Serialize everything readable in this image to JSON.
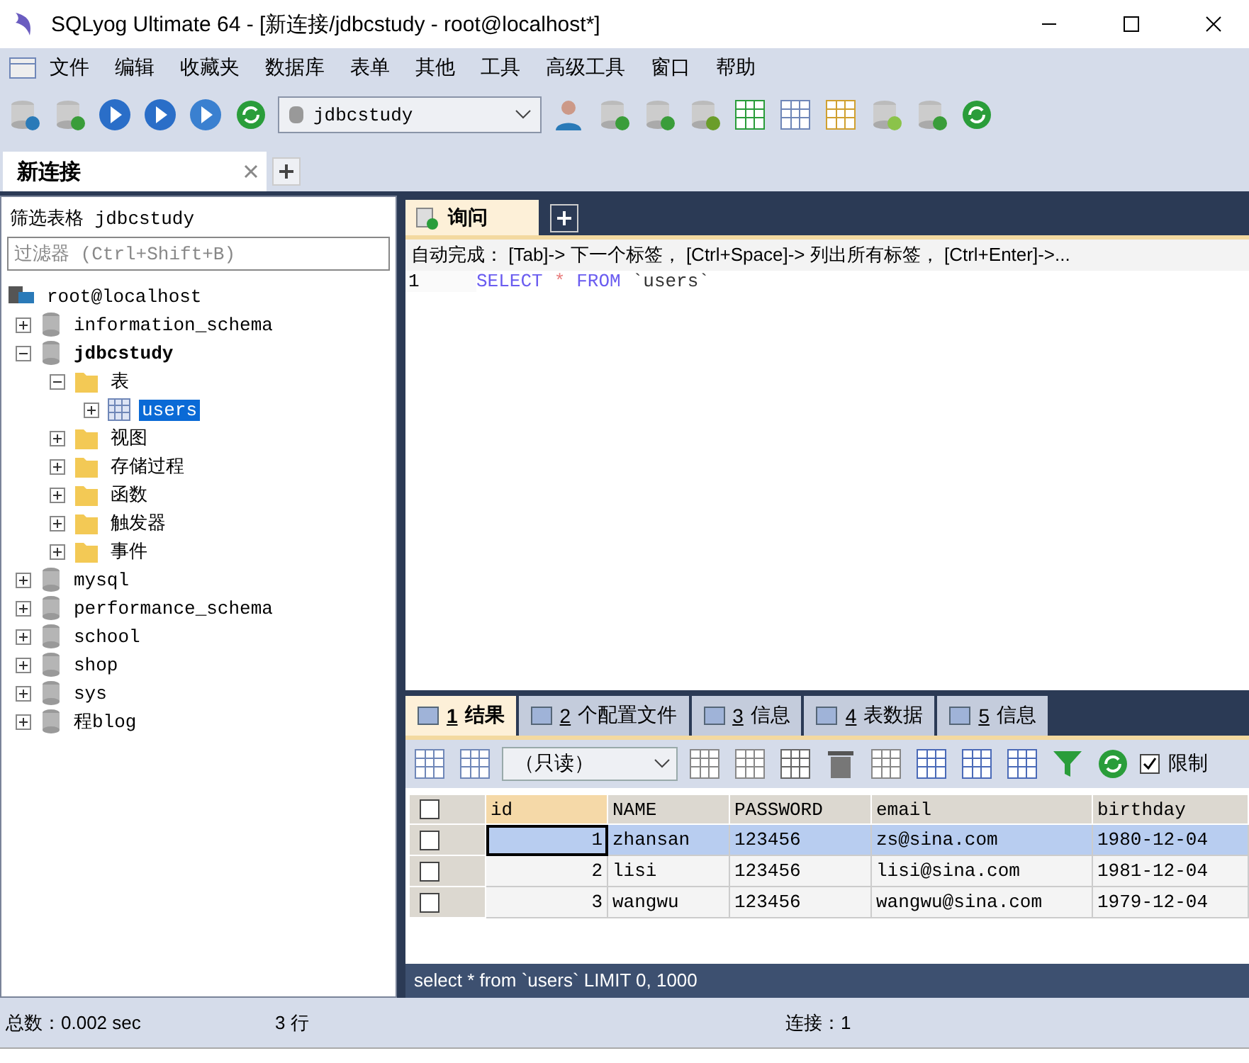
{
  "window": {
    "title": "SQLyog Ultimate 64 - [新连接/jdbcstudy - root@localhost*]"
  },
  "menu": [
    "文件",
    "编辑",
    "收藏夹",
    "数据库",
    "表单",
    "其他",
    "工具",
    "高级工具",
    "窗口",
    "帮助"
  ],
  "toolbar": {
    "database": "jdbcstudy"
  },
  "connection_tabs": [
    {
      "label": "新连接",
      "selected": true
    }
  ],
  "object_browser": {
    "heading": "筛选表格 jdbcstudy",
    "filter_placeholder": "过滤器 (Ctrl+Shift+B)",
    "root": "root@localhost",
    "tree": [
      {
        "label": "information_schema",
        "kind": "database",
        "expanded": false,
        "selected": false,
        "current": false
      },
      {
        "label": "jdbcstudy",
        "kind": "database",
        "expanded": true,
        "selected": false,
        "current": true,
        "children": [
          {
            "label": "表",
            "kind": "folder",
            "expanded": true,
            "selected": false,
            "current": false,
            "children": [
              {
                "label": "users",
                "kind": "table",
                "expanded": false,
                "selected": true,
                "current": false
              }
            ]
          },
          {
            "label": "视图",
            "kind": "folder",
            "expanded": false,
            "selected": false,
            "current": false
          },
          {
            "label": "存储过程",
            "kind": "folder",
            "expanded": false,
            "selected": false,
            "current": false
          },
          {
            "label": "函数",
            "kind": "folder",
            "expanded": false,
            "selected": false,
            "current": false
          },
          {
            "label": "触发器",
            "kind": "folder",
            "expanded": false,
            "selected": false,
            "current": false
          },
          {
            "label": "事件",
            "kind": "folder",
            "expanded": false,
            "selected": false,
            "current": false
          }
        ]
      },
      {
        "label": "mysql",
        "kind": "database",
        "expanded": false,
        "selected": false,
        "current": false
      },
      {
        "label": "performance_schema",
        "kind": "database",
        "expanded": false,
        "selected": false,
        "current": false
      },
      {
        "label": "school",
        "kind": "database",
        "expanded": false,
        "selected": false,
        "current": false
      },
      {
        "label": "shop",
        "kind": "database",
        "expanded": false,
        "selected": false,
        "current": false
      },
      {
        "label": "sys",
        "kind": "database",
        "expanded": false,
        "selected": false,
        "current": false
      },
      {
        "label": "程blog",
        "kind": "database",
        "expanded": false,
        "selected": false,
        "current": false
      }
    ]
  },
  "query_tabs": [
    {
      "label": "询问",
      "selected": true
    }
  ],
  "autocomplete_hint": "自动完成： [Tab]-> 下一个标签， [Ctrl+Space]-> 列出所有标签， [Ctrl+Enter]->...",
  "editor": {
    "lines": [
      {
        "number": "1",
        "tokens": [
          {
            "text": "SELECT",
            "kind": "keyword"
          },
          {
            "text": "*",
            "kind": "operator"
          },
          {
            "text": "FROM",
            "kind": "keyword"
          },
          {
            "text": "`users`",
            "kind": "identifier"
          }
        ]
      }
    ]
  },
  "result_tabs": [
    {
      "number": "1",
      "label": "结果",
      "selected": true
    },
    {
      "number": "2",
      "label": "个配置文件",
      "selected": false
    },
    {
      "number": "3",
      "label": "信息",
      "selected": false
    },
    {
      "number": "4",
      "label": "表数据",
      "selected": false
    },
    {
      "number": "5",
      "label": "信息",
      "selected": false
    }
  ],
  "result_toolbar": {
    "mode": "（只读）",
    "limit_label": "限制",
    "limit_checked": true
  },
  "grid": {
    "all_checked": false,
    "columns": [
      "id",
      "NAME",
      "PASSWORD",
      "email",
      "birthday"
    ],
    "rows": [
      {
        "cells": [
          "1",
          "zhansan",
          "123456",
          "zs@sina.com",
          "1980-12-04"
        ],
        "selected": true,
        "checked": false
      },
      {
        "cells": [
          "2",
          "lisi",
          "123456",
          "lisi@sina.com",
          "1981-12-04"
        ],
        "selected": false,
        "checked": false
      },
      {
        "cells": [
          "3",
          "wangwu",
          "123456",
          "wangwu@sina.com",
          "1979-12-04"
        ],
        "selected": false,
        "checked": false
      }
    ]
  },
  "sql_status": "select * from `users` LIMIT 0, 1000",
  "status_bar": [
    "总数：0.002 sec",
    "3 行",
    "连接：1"
  ]
}
